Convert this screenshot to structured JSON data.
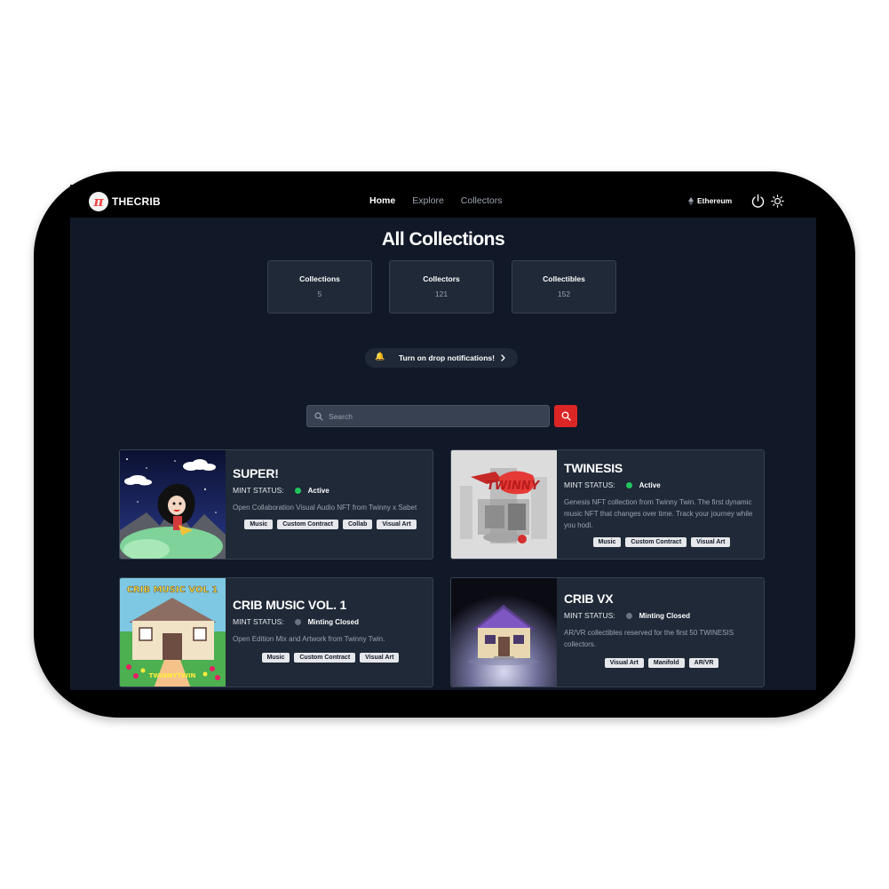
{
  "logo": {
    "glyph": "π",
    "text": "THECRIB"
  },
  "nav": {
    "items": [
      "Home",
      "Explore",
      "Collectors"
    ]
  },
  "network": {
    "label": "Ethereum"
  },
  "page": {
    "title": "All Collections"
  },
  "stats": [
    {
      "label": "Collections",
      "value": "5"
    },
    {
      "label": "Collectors",
      "value": "121"
    },
    {
      "label": "Collectibles",
      "value": "152"
    }
  ],
  "notify": {
    "icon": "bell-icon",
    "bell": "🔔",
    "label": "Turn on drop notifications!"
  },
  "search": {
    "placeholder": "Search"
  },
  "colors": {
    "active": "#22c55e",
    "closed": "#6b7280",
    "accent": "#dc2626"
  },
  "cards": [
    {
      "title": "SUPER!",
      "mint_label": "MINT STATUS:",
      "status": "Active",
      "description": "Open Collaboration Visual Audio NFT from Twinny x Sabet",
      "tags": [
        "Music",
        "Custom Contract",
        "Collab",
        "Visual Art"
      ]
    },
    {
      "title": "TWINESIS",
      "mint_label": "MINT STATUS:",
      "status": "Active",
      "description": "Genesis NFT collection from Twinny Twin. The first dynamic music NFT that changes over time. Track your journey while you hodl.",
      "tags": [
        "Music",
        "Custom Contract",
        "Visual Art"
      ]
    },
    {
      "title": "CRIB MUSIC VOL. 1",
      "mint_label": "MINT STATUS:",
      "status": "Minting Closed",
      "description": "Open Edition Mix and Artwork from Twinny Twin.",
      "tags": [
        "Music",
        "Custom Contract",
        "Visual Art"
      ],
      "art_text": "CRIB MUSIC VOL 1",
      "art_sub": "TWINNYTWIN"
    },
    {
      "title": "CRIB VX",
      "mint_label": "MINT STATUS:",
      "status": "Minting Closed",
      "description": "AR/VR collectibles reserved for the first 50 TWINESIS collectors.",
      "tags": [
        "Visual Art",
        "Manifold",
        "AR/VR"
      ]
    }
  ]
}
